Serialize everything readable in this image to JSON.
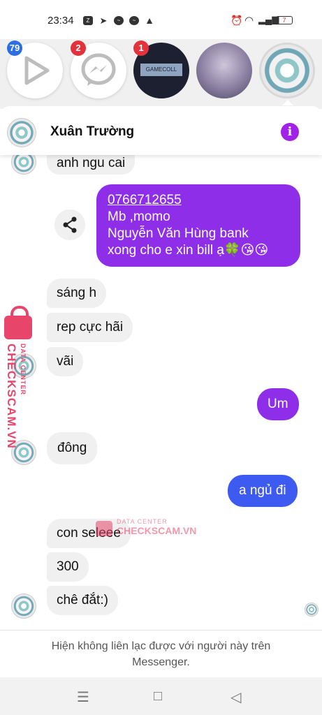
{
  "status_bar": {
    "time": "23:34",
    "battery": "7"
  },
  "chat_heads": [
    {
      "name": "play-head",
      "badge": "79"
    },
    {
      "name": "messenger-head",
      "badge": "2"
    },
    {
      "name": "gamecoll-head",
      "badge": "1",
      "label": "GAMECOLL"
    },
    {
      "name": "forest-head"
    },
    {
      "name": "mandala-head"
    }
  ],
  "chat": {
    "contact_name": "Xuân Trường",
    "messages": [
      {
        "from": "them",
        "text": "anh ngu cai"
      },
      {
        "from": "me",
        "lines": [
          "0766712655",
          "Mb ,momo",
          "Nguyễn Văn Hùng bank",
          "xong cho e xin bill ạ🍀😘😘"
        ]
      },
      {
        "from": "them",
        "text": "sáng h"
      },
      {
        "from": "them",
        "text": "rep cực hãi"
      },
      {
        "from": "them",
        "text": "vãi"
      },
      {
        "from": "me",
        "text": "Um"
      },
      {
        "from": "them",
        "text": "đông"
      },
      {
        "from": "me",
        "text": "a ngủ đi"
      },
      {
        "from": "them",
        "text": "con seleee"
      },
      {
        "from": "them",
        "text": "300"
      },
      {
        "from": "them",
        "text": "chê đắt:)"
      }
    ],
    "footer_notice": "Hiện không liên lạc được với người này trên Messenger."
  },
  "watermark": {
    "brand": "CHECKSCAM.VN",
    "sub": "DATA CENTER"
  },
  "colors": {
    "accent": "#a221e8",
    "bubble_purple": "#8f2ee9",
    "bubble_blue": "#3d5af1",
    "badge_red": "#e4323d"
  }
}
